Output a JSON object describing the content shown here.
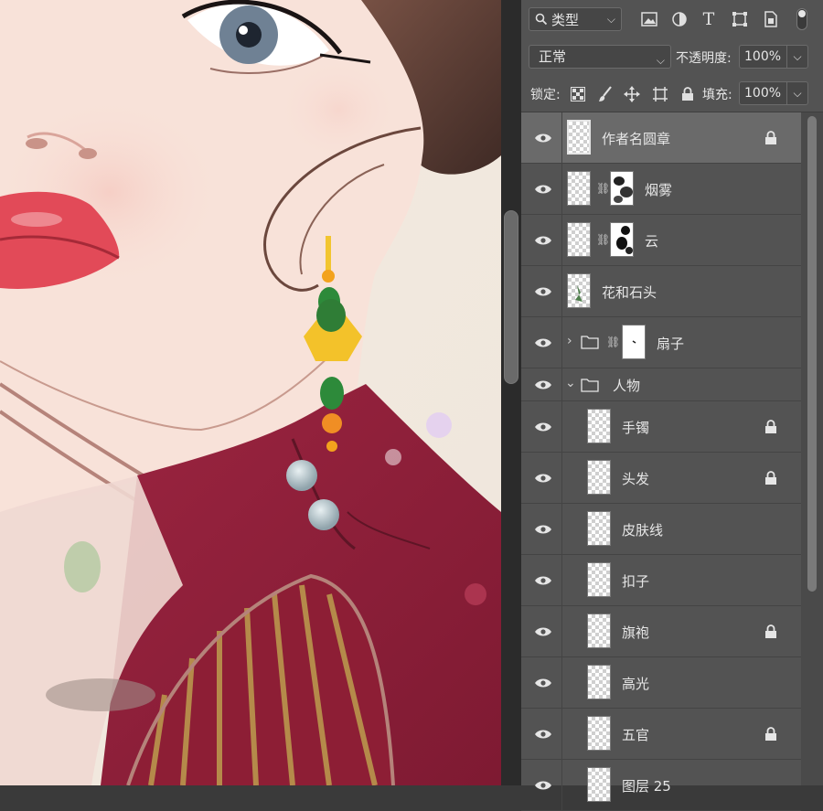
{
  "filter_bar": {
    "kind_label": "类型",
    "icons": [
      "image-filter-icon",
      "adjustment-filter-icon",
      "text-filter-icon",
      "shape-filter-icon",
      "smart-object-filter-icon"
    ]
  },
  "blend": {
    "mode": "正常",
    "opacity_label": "不透明度:",
    "opacity_value": "100%"
  },
  "lock_bar": {
    "label": "锁定:",
    "fill_label": "填充:",
    "fill_value": "100%"
  },
  "layers": [
    {
      "name": "作者名圆章",
      "type": "layer",
      "selected": true,
      "locked": true
    },
    {
      "name": "烟雾",
      "type": "layer_mask",
      "selected": false,
      "locked": false
    },
    {
      "name": "云",
      "type": "layer_mask",
      "selected": false,
      "locked": false
    },
    {
      "name": "花和石头",
      "type": "layer",
      "selected": false,
      "locked": false
    },
    {
      "name": "扇子",
      "type": "group_mask",
      "collapsed": true,
      "locked": false
    },
    {
      "name": "人物",
      "type": "group",
      "collapsed": false,
      "locked": false
    },
    {
      "name": "手镯",
      "type": "child",
      "locked": true
    },
    {
      "name": "头发",
      "type": "child",
      "locked": true
    },
    {
      "name": "皮肤线",
      "type": "child",
      "locked": false
    },
    {
      "name": "扣子",
      "type": "child",
      "locked": false
    },
    {
      "name": "旗袍",
      "type": "child",
      "locked": true
    },
    {
      "name": "高光",
      "type": "child",
      "locked": false
    },
    {
      "name": "五官",
      "type": "child",
      "locked": true
    },
    {
      "name": "图层 25",
      "type": "child",
      "locked": false
    }
  ],
  "colors": {
    "panel_bg": "#535353",
    "selected_row": "#6a6a6a",
    "qipao_red": "#8b1f36",
    "skin": "#f7e1d8"
  }
}
